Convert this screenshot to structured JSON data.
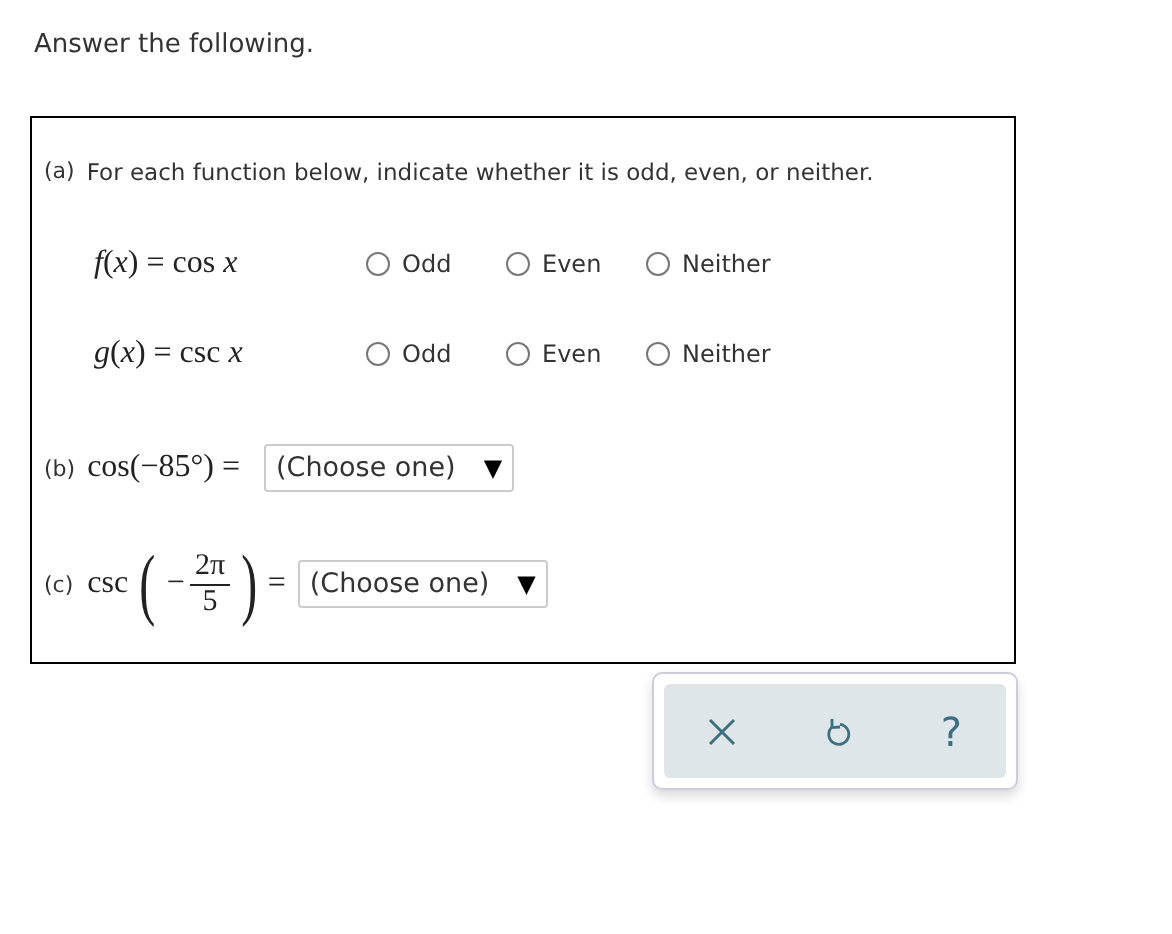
{
  "instruction": "Answer the following.",
  "part_a": {
    "label": "(a)",
    "prompt": "For each function below, indicate whether it is odd, even, or neither.",
    "rows": [
      {
        "expression": "*f*(*x*) = cos *x*",
        "options": [
          {
            "label": "Odd",
            "selected": false
          },
          {
            "label": "Even",
            "selected": false
          },
          {
            "label": "Neither",
            "selected": false
          }
        ]
      },
      {
        "expression": "*g*(*x*) = csc *x*",
        "options": [
          {
            "label": "Odd",
            "selected": false
          },
          {
            "label": "Even",
            "selected": false
          },
          {
            "label": "Neither",
            "selected": false
          }
        ]
      }
    ]
  },
  "part_b": {
    "label": "(b)",
    "expression": "cos(−85°) =",
    "dropdown": {
      "value": "(Choose one)",
      "arrow": "▼"
    }
  },
  "part_c": {
    "label": "(c)",
    "function": "csc",
    "open_paren": "(",
    "sign": "−",
    "numerator": "2π",
    "denominator": "5",
    "close_paren": ")",
    "equals": "=",
    "dropdown": {
      "value": "(Choose one)",
      "arrow": "▼"
    }
  },
  "toolbar": {
    "help": "?"
  }
}
